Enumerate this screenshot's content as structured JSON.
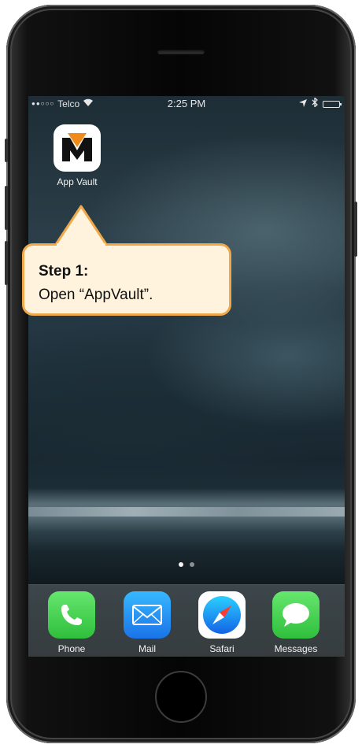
{
  "status_bar": {
    "carrier": "Telco",
    "time": "2:25  PM"
  },
  "home_screen": {
    "apps": [
      {
        "label": "App Vault",
        "icon": "appvault-logo-icon"
      }
    ],
    "page_dots": 2,
    "active_page": 0
  },
  "dock": {
    "apps": [
      {
        "label": "Phone",
        "icon": "phone-icon",
        "color": "#4cd964"
      },
      {
        "label": "Mail",
        "icon": "mail-icon",
        "color": "#1e90ff"
      },
      {
        "label": "Safari",
        "icon": "safari-compass-icon",
        "color": "#ffffff"
      },
      {
        "label": "Messages",
        "icon": "messages-bubble-icon",
        "color": "#4cd964"
      }
    ]
  },
  "callout": {
    "title": "Step 1:",
    "text": "Open “AppVault”.",
    "border_color": "#f0a94a",
    "fill_color": "#fff3de"
  }
}
